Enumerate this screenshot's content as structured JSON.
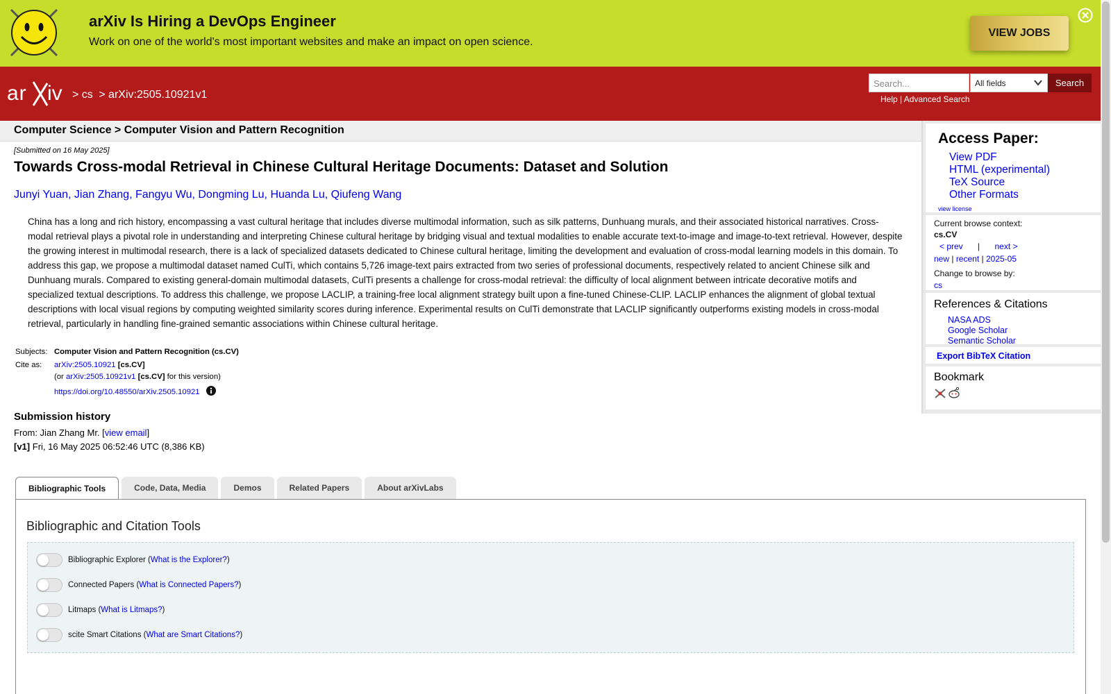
{
  "banner": {
    "title": "arXiv Is Hiring a DevOps Engineer",
    "subtitle": "Work on one of the world's most important websites and make an impact on open science.",
    "cta": "VIEW JOBS",
    "bg_color": "#c6dd2c"
  },
  "header": {
    "brand": "arXiv",
    "crumbs": [
      "> cs",
      "> arXiv:2505.10921v1"
    ],
    "search_placeholder": "Search...",
    "search_field": "All fields",
    "search_button": "Search",
    "help_links": "Help | Advanced Search",
    "bg_color": "#b31b1b"
  },
  "subheader": "Computer Science > Computer Vision and Pattern Recognition",
  "paper": {
    "submitted": "[Submitted on 16 May 2025]",
    "title": "Towards Cross-modal Retrieval in Chinese Cultural Heritage Documents: Dataset and Solution",
    "authors": [
      "Junyi Yuan",
      "Jian Zhang",
      "Fangyu Wu",
      "Dongming Lu",
      "Huanda Lu",
      "Qiufeng Wang"
    ],
    "abstract": "China has a long and rich history, encompassing a vast cultural heritage that includes diverse multimodal information, such as silk patterns, Dunhuang murals, and their associated historical narratives. Cross-modal retrieval plays a pivotal role in understanding and interpreting Chinese cultural heritage by bridging visual and textual modalities to enable accurate text-to-image and image-to-text retrieval. However, despite the growing interest in multimodal research, there is a lack of specialized datasets dedicated to Chinese cultural heritage, limiting the development and evaluation of cross-modal learning models in this domain. To address this gap, we propose a multimodal dataset named CulTi, which contains 5,726 image-text pairs extracted from two series of professional documents, respectively related to ancient Chinese silk and Dunhuang murals. Compared to existing general-domain multimodal datasets, CulTi presents a challenge for cross-modal retrieval: the difficulty of local alignment between intricate decorative motifs and specialized textual descriptions. To address this challenge, we propose LACLIP, a training-free local alignment strategy built upon a fine-tuned Chinese-CLIP. LACLIP enhances the alignment of global textual descriptions with local visual regions by computing weighted similarity scores during inference. Experimental results on CulTi demonstrate that LACLIP significantly outperforms existing models in cross-modal retrieval, particularly in handling fine-grained semantic associations within Chinese cultural heritage.",
    "subjects_label": "Subjects:",
    "subjects_value": "Computer Vision and Pattern Recognition (cs.CV)",
    "cite_label": "Cite as:",
    "cite_id": "arXiv:2505.10921",
    "cite_cat": "[cs.CV]",
    "cite_or": "(or",
    "cite_version_id": "arXiv:2505.10921v1",
    "cite_version_cat": "[cs.CV]",
    "cite_version_suffix": "for this version)",
    "doi": "https://doi.org/10.48550/arXiv.2505.10921"
  },
  "history": {
    "title": "Submission history",
    "from_prefix": "From: Jian Zhang Mr. [",
    "view_email": "view email",
    "from_suffix": "]",
    "v1_label": "[v1]",
    "v1_text": "Fri, 16 May 2025 06:52:46 UTC (8,386 KB)"
  },
  "tabs": [
    "Bibliographic Tools",
    "Code, Data, Media",
    "Demos",
    "Related Papers",
    "About arXivLabs"
  ],
  "panel": {
    "title": "Bibliographic and Citation Tools",
    "tools": [
      {
        "name": "Bibliographic Explorer (",
        "link": "What is the Explorer?",
        "close": ")"
      },
      {
        "name": "Connected Papers (",
        "link": "What is Connected Papers?",
        "close": ")"
      },
      {
        "name": "Litmaps (",
        "link": "What is Litmaps?",
        "close": ")"
      },
      {
        "name": "scite Smart Citations (",
        "link": "What are Smart Citations?",
        "close": ")"
      }
    ]
  },
  "sidebar": {
    "access_title": "Access Paper:",
    "access_links": [
      "View PDF",
      "HTML (experimental)",
      "TeX Source",
      "Other Formats"
    ],
    "view_license": "view license",
    "context_label": "Current browse context:",
    "context_value": "cs.CV",
    "prev": "< prev",
    "sep": "|",
    "next": "next >",
    "new": "new",
    "recent": "recent",
    "month": "2025-05",
    "change_label": "Change to browse by:",
    "change_value": "cs",
    "refs_title": "References & Citations",
    "refs_links": [
      "NASA ADS",
      "Google Scholar",
      "Semantic Scholar"
    ],
    "export": "Export BibTeX Citation",
    "bookmark_title": "Bookmark"
  }
}
